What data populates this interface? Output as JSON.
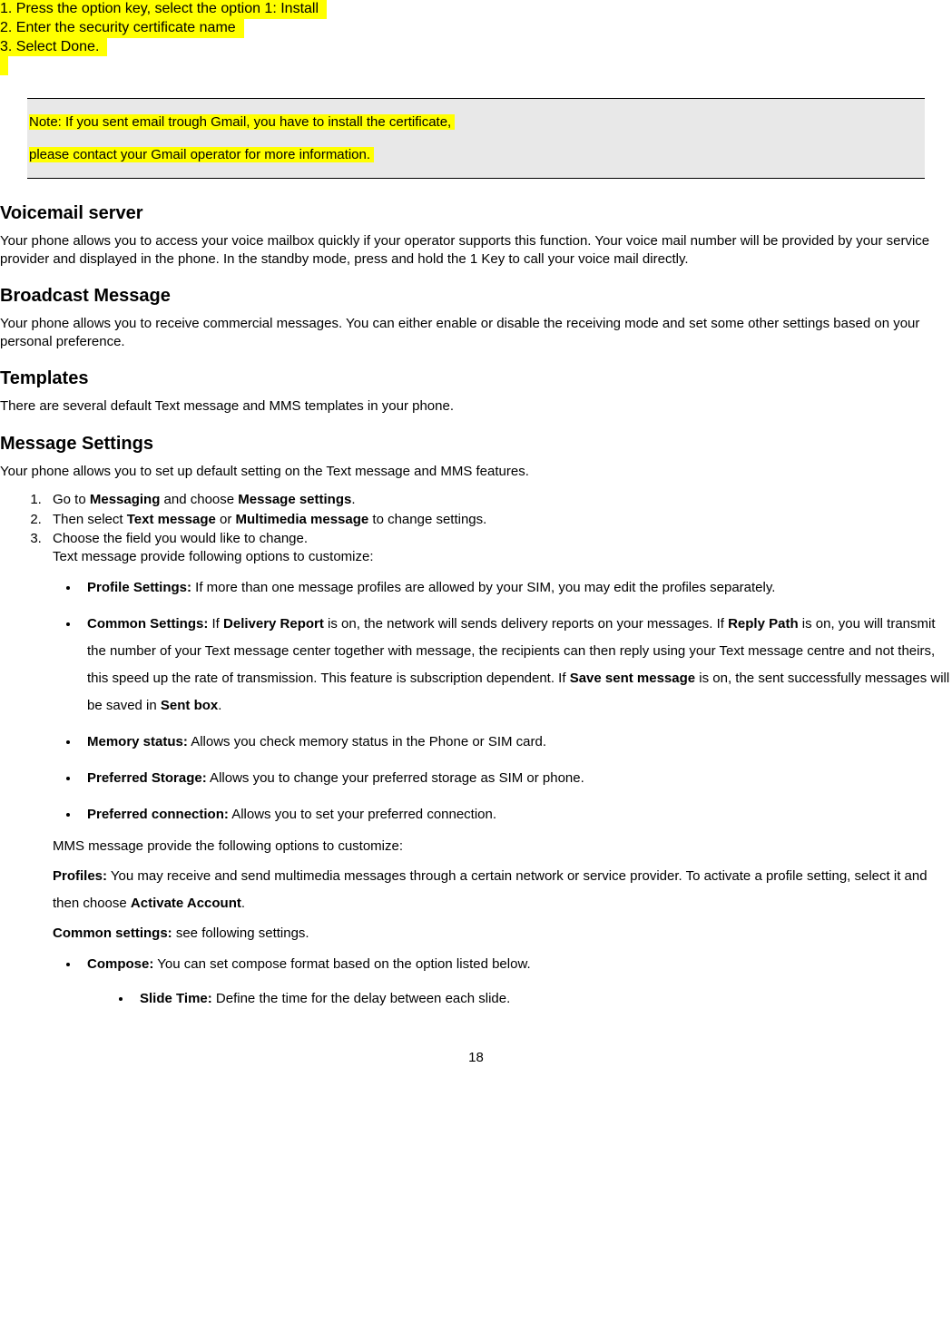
{
  "topSteps": {
    "line1": "1. Press the option key, select the option 1: Install",
    "line2": "2. Enter the security certificate name",
    "line3": "3. Select Done."
  },
  "noteBox": {
    "line1": "Note: If you sent email trough Gmail, you have to install the certificate,",
    "line2": "please contact your Gmail operator for more information."
  },
  "voicemail": {
    "heading": "Voicemail server",
    "text": "Your phone allows you to access your voice mailbox quickly if your operator supports this function. Your voice mail number will be provided by your service provider and displayed in the phone. In the standby mode, press and hold the 1 Key to call your voice mail directly."
  },
  "broadcast": {
    "heading": "Broadcast Message",
    "text": "Your phone allows you to receive commercial messages. You can either enable or disable the receiving mode and set some other settings based on your personal preference."
  },
  "templates": {
    "heading": "Templates",
    "text": "There are several default Text message and MMS templates in your phone."
  },
  "msgSettings": {
    "heading": "Message Settings",
    "intro": "Your phone allows you to set up default setting on the Text message and MMS features.",
    "step1_pre": "Go to ",
    "step1_b1": "Messaging",
    "step1_mid": " and choose ",
    "step1_b2": "Message settings",
    "step1_end": ".",
    "step2_pre": "Then select ",
    "step2_b1": "Text message",
    "step2_mid": " or ",
    "step2_b2": "Multimedia message",
    "step2_end": " to change settings.",
    "step3": "Choose the field you would like to change.",
    "step3_sub": "Text message provide following options to customize:",
    "bullet1_b": "Profile Settings:",
    "bullet1_text": " If more than one message profiles are allowed by your SIM, you may edit the profiles separately.",
    "bullet2_b": "Common Settings:",
    "bullet2_text1": " If ",
    "bullet2_b2": "Delivery Report",
    "bullet2_text2": " is on, the network will sends delivery reports on your messages. If ",
    "bullet2_b3": "Reply Path",
    "bullet2_text3": " is on, you will transmit the number of your Text message center together with message, the recipients can then reply using your Text message centre and not theirs, this speed up the rate of transmission. This feature is subscription dependent. If ",
    "bullet2_b4": "Save sent message",
    "bullet2_text4": " is on, the sent successfully messages will be saved in ",
    "bullet2_b5": "Sent box",
    "bullet2_text5": ".",
    "bullet3_b": "Memory status:",
    "bullet3_text": " Allows you check memory status in the Phone or SIM card.",
    "bullet4_b": "Preferred Storage:",
    "bullet4_text": " Allows you to change your preferred storage as SIM or phone.",
    "bullet5_b": "Preferred connection:",
    "bullet5_text": " Allows you to set your preferred connection.",
    "mmsIntro": "MMS message provide the following options to customize:",
    "profiles_b": "Profiles:",
    "profiles_text": " You may receive and send multimedia messages through a certain network or service provider. To activate a profile setting, select it and then choose ",
    "profiles_b2": "Activate Account",
    "profiles_end": ".",
    "common_b": "Common settings:",
    "common_text": " see following settings.",
    "compose_b": "Compose:",
    "compose_text": " You can set compose format based on the option listed below.",
    "slide_b": "Slide Time:",
    "slide_text": " Define the time for the delay between each slide."
  },
  "pageNumber": "18"
}
